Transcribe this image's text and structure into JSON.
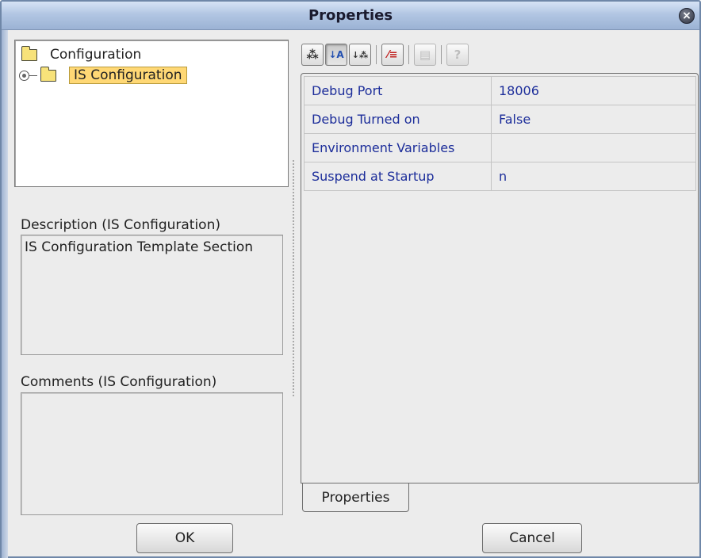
{
  "window": {
    "title": "Properties",
    "close_label": "×"
  },
  "tree": {
    "root_label": "Configuration",
    "child_label": "IS Configuration"
  },
  "description": {
    "label": "Description (IS Configuration)",
    "text": "IS Configuration Template Section"
  },
  "comments": {
    "label": "Comments (IS Configuration)",
    "text": ""
  },
  "toolbar": {
    "buttons": [
      {
        "name": "categorized",
        "glyph": "⁂",
        "state": "normal"
      },
      {
        "name": "sort-alpha",
        "glyph": "↓A",
        "state": "pressed"
      },
      {
        "name": "sort-type",
        "glyph": "↓⁂",
        "state": "normal"
      },
      {
        "name": "show-descriptions",
        "glyph": "⁄≡",
        "state": "normal"
      },
      {
        "name": "list-view",
        "glyph": "▤",
        "state": "disabled"
      },
      {
        "name": "help",
        "glyph": "?",
        "state": "disabled"
      }
    ]
  },
  "properties": {
    "rows": [
      {
        "name": "Debug Port",
        "value": "18006"
      },
      {
        "name": "Debug Turned on",
        "value": "False"
      },
      {
        "name": "Environment Variables",
        "value": ""
      },
      {
        "name": "Suspend at Startup",
        "value": "n"
      }
    ],
    "tab_label": "Properties"
  },
  "buttons": {
    "ok_label": "OK",
    "cancel_label": "Cancel"
  }
}
